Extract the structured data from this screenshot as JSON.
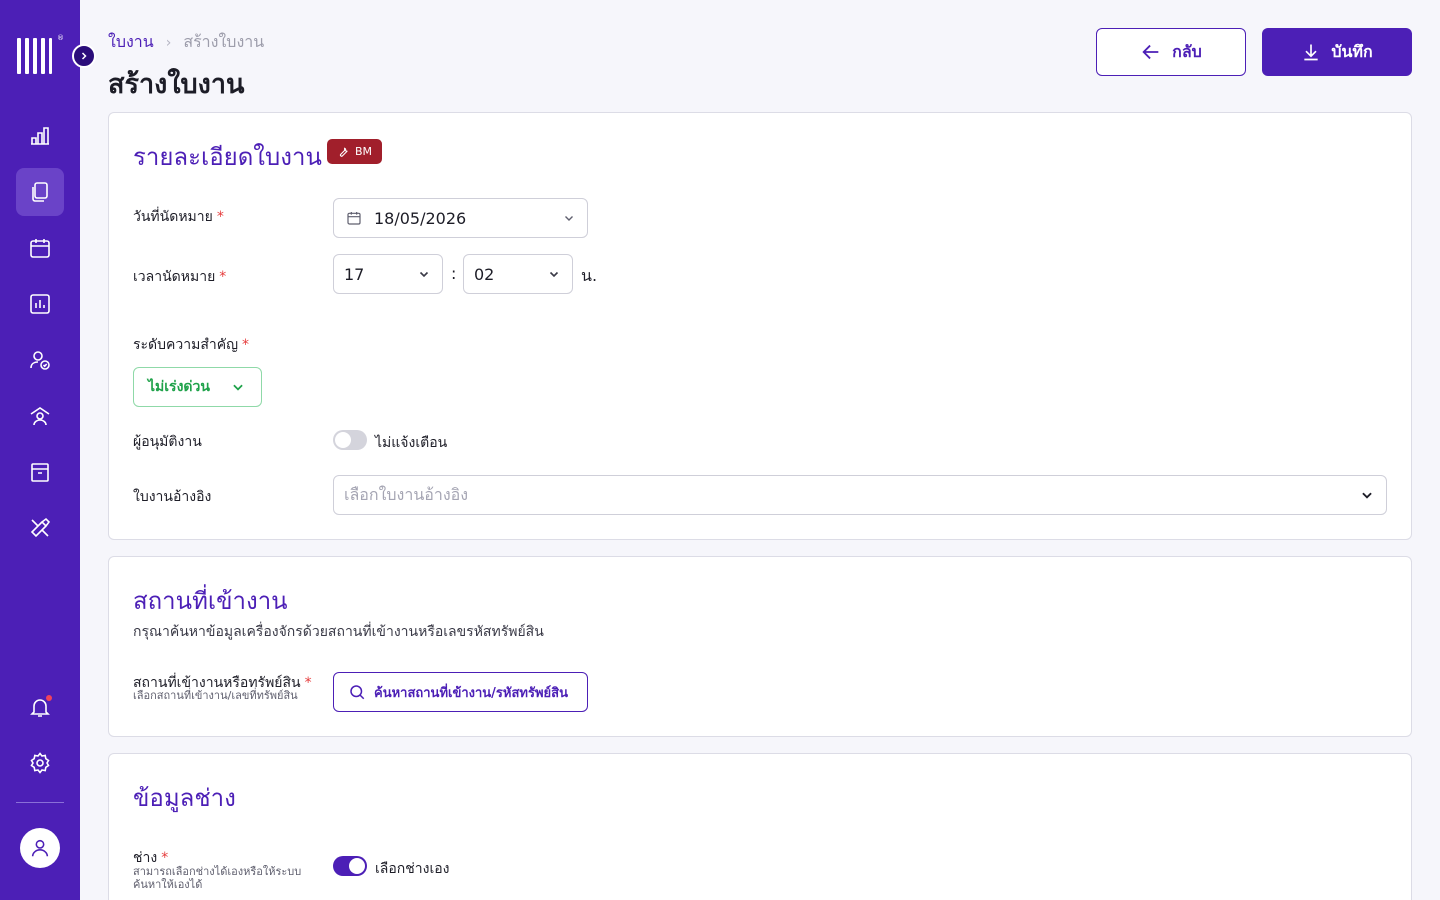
{
  "breadcrumb": {
    "parent": "ใบงาน",
    "separator": "›",
    "current": "สร้างใบงาน"
  },
  "page_title": "สร้างใบงาน",
  "actions": {
    "back_label": "กลับ",
    "save_label": "บันทึก"
  },
  "details": {
    "title": "รายละเอียดใบงาน",
    "badge": "BM",
    "date_label": "วันที่นัดหมาย",
    "date_value": "18/05/2026",
    "time_label": "เวลานัดหมาย",
    "hour_value": "17",
    "minute_value": "02",
    "time_separator": ":",
    "time_unit": "น.",
    "priority_label": "ระดับความสำคัญ",
    "priority_value": "ไม่เร่งด่วน",
    "approver_label": "ผู้อนุมัติงาน",
    "approver_toggle_text": "ไม่แจ้งเตือน",
    "reference_label": "ใบงานอ้างอิง",
    "reference_placeholder": "เลือกใบงานอ้างอิง",
    "required_mark": "*"
  },
  "location": {
    "title": "สถานที่เข้างาน",
    "description": "กรุณาค้นหาข้อมูลเครื่องจักรด้วยสถานที่เข้างานหรือเลขรหัสทรัพย์สิน",
    "field_label": "สถานที่เข้างานหรือทรัพย์สิน",
    "field_sublabel": "เลือกสถานที่เข้างาน/เลขที่ทรัพย์สิน",
    "search_button": "ค้นหาสถานที่เข้างาน/รหัสทรัพย์สิน"
  },
  "technician": {
    "title": "ข้อมูลช่าง",
    "label": "ช่าง",
    "sublabel": "สามารถเลือกช่างได้เองหรือให้ระบบค้นหาให้เองได้",
    "toggle_text": "เลือกช่างเอง"
  },
  "colors": {
    "brand": "#4c1fb6",
    "sidebar": "#4c1fb6",
    "badge": "#a11f2b",
    "priority": "#1fa24a",
    "required": "#e53b3b"
  }
}
